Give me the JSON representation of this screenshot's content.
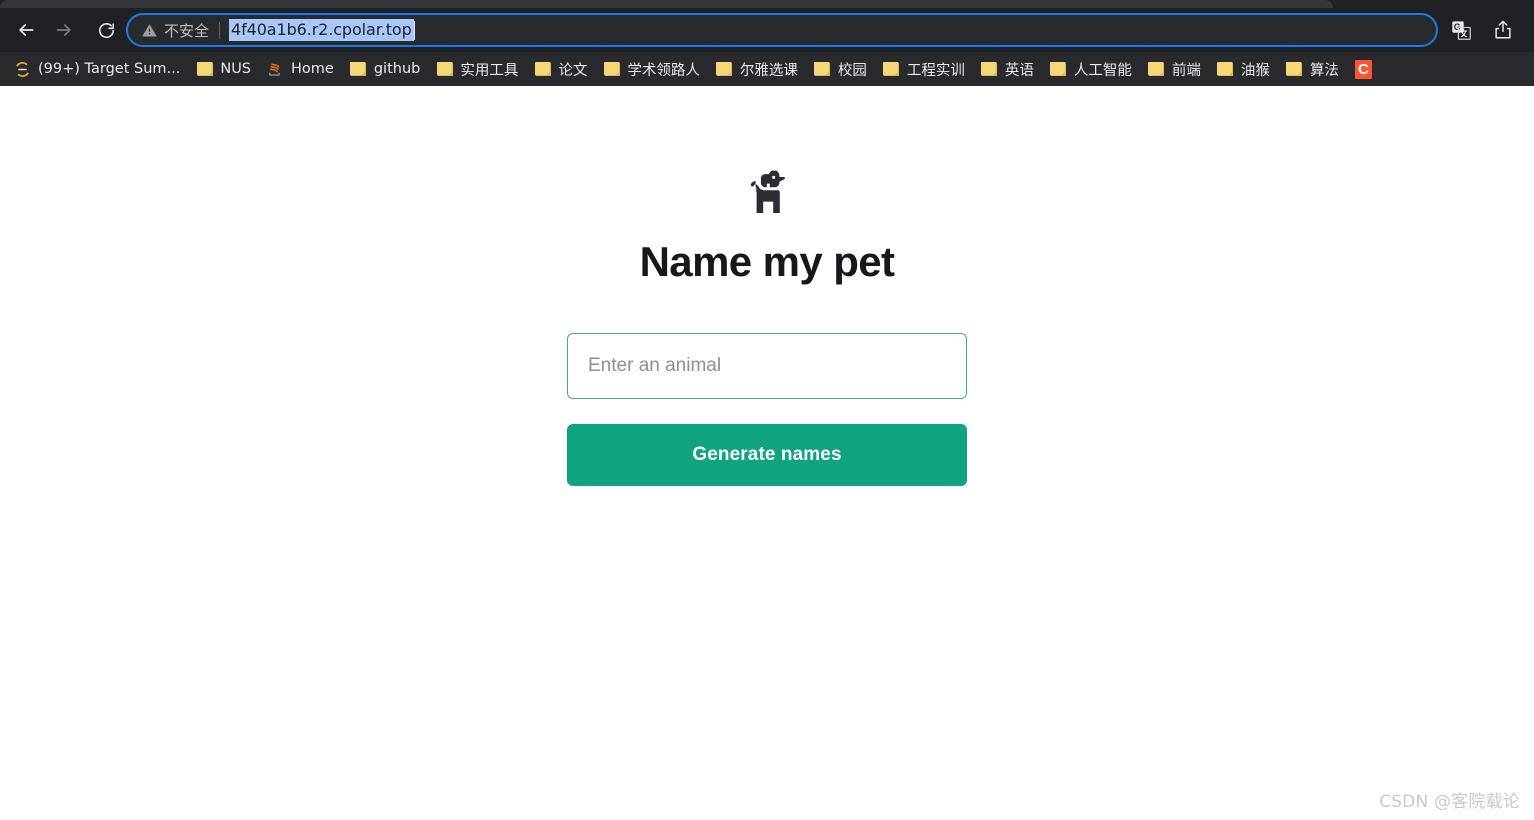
{
  "browser": {
    "nav": {
      "back_icon": "arrow-left-icon",
      "forward_icon": "arrow-right-icon",
      "reload_icon": "reload-icon"
    },
    "omnibox": {
      "security_icon": "warning-triangle-icon",
      "security_label": "不安全",
      "url": "4f40a1b6.r2.cpolar.top",
      "selected": true
    },
    "toolbar_icons": [
      {
        "name": "translate-icon",
        "label": "翻译"
      },
      {
        "name": "share-icon",
        "label": "分享"
      }
    ],
    "bookmarks": [
      {
        "label": "(99+) Target Sum...",
        "icon": "swirl-logo-icon"
      },
      {
        "label": "NUS",
        "icon": "folder-icon"
      },
      {
        "label": "Home",
        "icon": "stack-logo-icon"
      },
      {
        "label": "github",
        "icon": "folder-icon"
      },
      {
        "label": "实用工具",
        "icon": "folder-icon"
      },
      {
        "label": "论文",
        "icon": "folder-icon"
      },
      {
        "label": "学术领路人",
        "icon": "folder-icon"
      },
      {
        "label": "尔雅选课",
        "icon": "folder-icon"
      },
      {
        "label": "校园",
        "icon": "folder-icon"
      },
      {
        "label": "工程实训",
        "icon": "folder-icon"
      },
      {
        "label": "英语",
        "icon": "folder-icon"
      },
      {
        "label": "人工智能",
        "icon": "folder-icon"
      },
      {
        "label": "前端",
        "icon": "folder-icon"
      },
      {
        "label": "油猴",
        "icon": "folder-icon"
      },
      {
        "label": "算法",
        "icon": "folder-icon"
      },
      {
        "label": "C",
        "icon": "csdn-square-icon"
      }
    ]
  },
  "page": {
    "logo_icon": "dog-icon",
    "title": "Name my pet",
    "input": {
      "placeholder": "Enter an animal",
      "value": ""
    },
    "submit_label": "Generate names",
    "watermark": "CSDN @客院载论"
  },
  "colors": {
    "accent_green": "#10a37f",
    "input_border": "#3fab8f",
    "chrome_bg": "#202124",
    "bookmarks_bg": "#292a2d",
    "omnibox_focus": "#1b79e8",
    "url_selection": "#a8c7fa",
    "csdn_red": "#fc5531",
    "folder_yellow": "#f7d775",
    "title_color": "#17181c"
  }
}
